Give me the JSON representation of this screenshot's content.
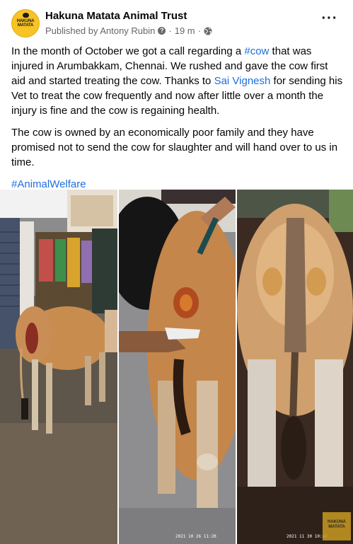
{
  "post": {
    "page_name": "Hakuna Matata Animal Trust",
    "published_by": "Published by Antony Rubin",
    "time": "19 m",
    "dot": "·",
    "avatar_text": "HAKUNA MATATA",
    "paragraphs": {
      "p1": {
        "t1": "In the month of October we got a call regarding a ",
        "link1": "#cow",
        "t2": " that was injured in Arumbakkam, Chennai. We rushed and gave the cow first aid and started treating the cow. Thanks to ",
        "link2": "Sai Vignesh",
        "t3": " for sending his Vet to treat the cow frequently and now after little over a month the injury is fine and the cow is regaining health."
      },
      "p2": "The cow is owned by an economically poor family and they have promised not to send the cow for slaughter and will hand over to us in time.",
      "hashtag": "#AnimalWelfare"
    }
  },
  "photos": {
    "stamp_text": "HAKUNA MATATA",
    "timestamp_2": "2021 10 26 11:20",
    "timestamp_3": "2021 11 30 10:42"
  },
  "icons": {
    "help": "question-circle-icon",
    "globe": "globe-icon",
    "more": "more-horizontal-icon"
  },
  "colors": {
    "link": "#216fdb",
    "secondary_text": "#65676b",
    "logo_yellow": "#f7c325"
  }
}
